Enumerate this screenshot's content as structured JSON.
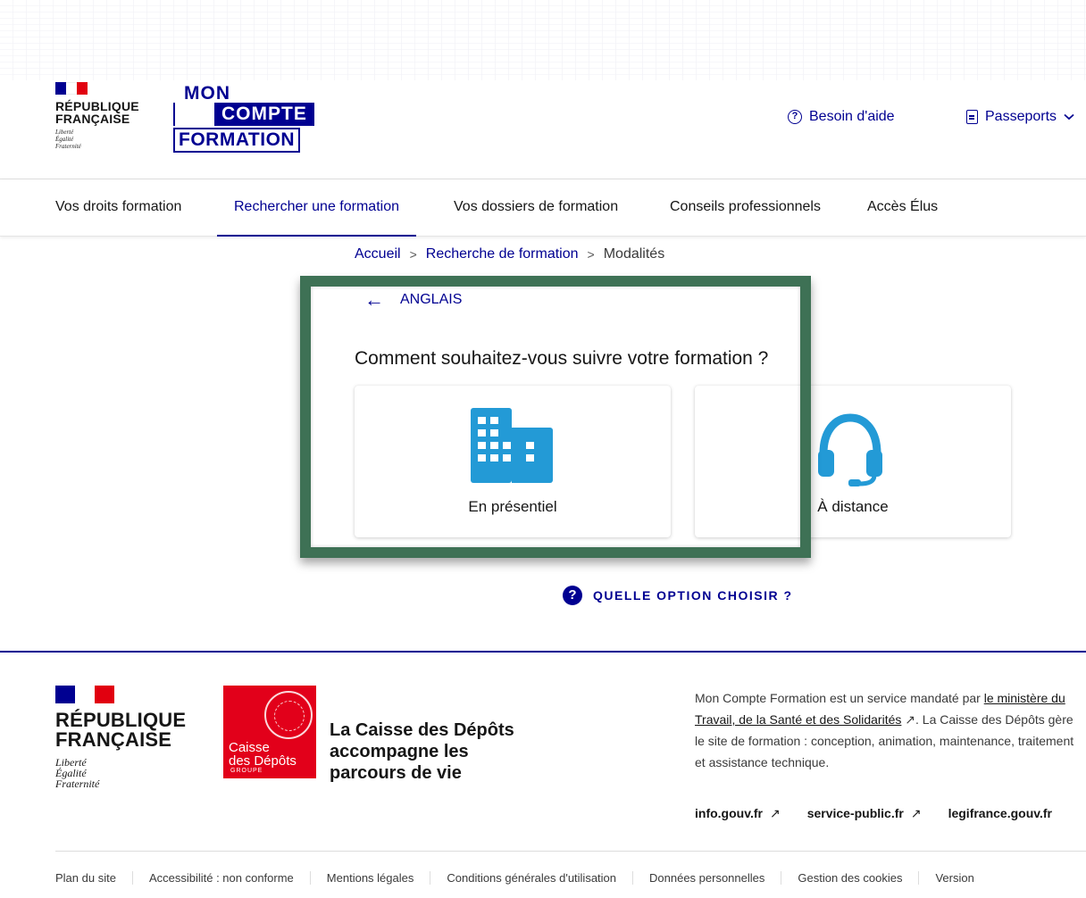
{
  "header": {
    "rf_title_line1": "RÉPUBLIQUE",
    "rf_title_line2": "FRANÇAISE",
    "rf_motto_1": "Liberté",
    "rf_motto_2": "Égalité",
    "rf_motto_3": "Fraternité",
    "logo_mon": "MON",
    "logo_compte": "COMPTE",
    "logo_formation": "FORMATION",
    "help_link": "Besoin d'aide",
    "help_icon": "?",
    "passports_link": "Passeports"
  },
  "nav": {
    "items": [
      {
        "label": "Vos droits formation"
      },
      {
        "label": "Rechercher une formation",
        "active": true
      },
      {
        "label": "Vos dossiers de formation"
      },
      {
        "label": "Conseils professionnels"
      },
      {
        "label": "Accès Élus"
      }
    ]
  },
  "breadcrumb": {
    "home": "Accueil",
    "search": "Recherche de formation",
    "current": "Modalités",
    "separator": ">"
  },
  "main": {
    "back_arrow": "←",
    "back_label": "ANGLAIS",
    "question": "Comment souhaitez-vous suivre votre formation ?",
    "options": [
      {
        "label": "En présentiel",
        "icon": "building-icon"
      },
      {
        "label": "À distance",
        "icon": "headset-icon"
      }
    ],
    "help_icon": "?",
    "help_choose": "QUELLE OPTION CHOISIR ?"
  },
  "footer": {
    "rf_title_line1": "RÉPUBLIQUE",
    "rf_title_line2": "FRANÇAISE",
    "rf_motto_1": "Liberté",
    "rf_motto_2": "Égalité",
    "rf_motto_3": "Fraternité",
    "cdc_line1": "Caisse",
    "cdc_line2": "des Dépôts",
    "cdc_group": "GROUPE",
    "tagline": "La Caisse des Dépôts accompagne les parcours de vie",
    "desc_part1": "Mon Compte Formation est un service mandaté par ",
    "desc_link1": "le ministère du Travail, de la Santé et des Solidarités",
    "desc_part2": ". La Caisse des Dépôts gère le site de formation : conception, animation, maintenance, traitement et assistance technique.",
    "links": [
      {
        "label": "info.gouv.fr"
      },
      {
        "label": "service-public.fr"
      },
      {
        "label": "legifrance.gouv.fr"
      }
    ],
    "ext_icon": "↗",
    "bottom_links": [
      {
        "label": "Plan du site"
      },
      {
        "label": "Accessibilité : non conforme"
      },
      {
        "label": "Mentions légales"
      },
      {
        "label": "Conditions générales d'utilisation"
      },
      {
        "label": "Données personnelles"
      },
      {
        "label": "Gestion des cookies"
      },
      {
        "label": "Version"
      }
    ]
  },
  "colors": {
    "primary": "#000091",
    "icon_blue": "#239ad6",
    "highlight_frame": "#3e7155",
    "marianne_red": "#e1000f",
    "cdc_red": "#e2001a"
  }
}
